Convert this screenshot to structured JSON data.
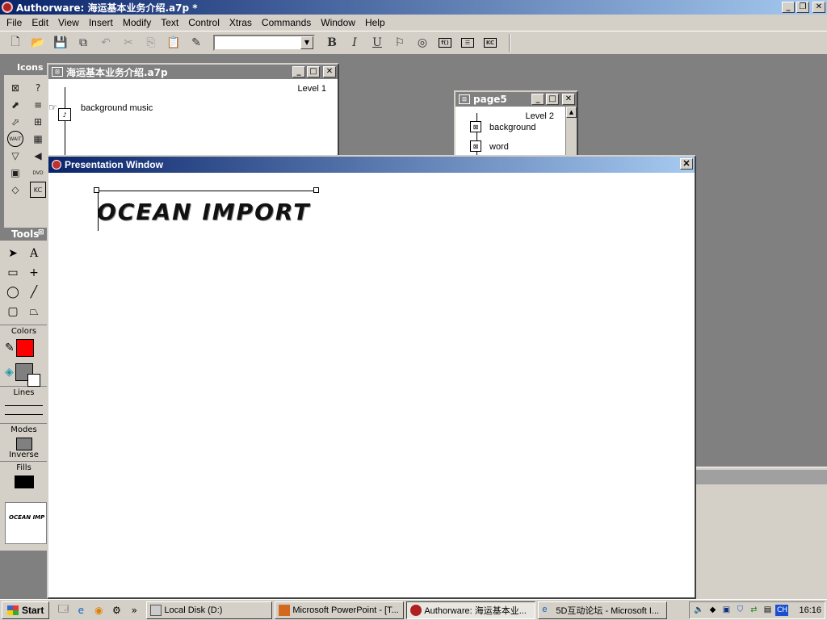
{
  "app": {
    "title": "Authorware: 海运基本业务介绍.a7p *"
  },
  "menu": [
    "File",
    "Edit",
    "View",
    "Insert",
    "Modify",
    "Text",
    "Control",
    "Xtras",
    "Commands",
    "Window",
    "Help"
  ],
  "toolbar": {
    "font_value": "",
    "bold": "B",
    "italic": "I",
    "underline": "U",
    "kc": "KC"
  },
  "icons_palette": {
    "title": "Icons",
    "wait_label": "WAIT",
    "dvd_label": "DVD",
    "kc_label": "KC"
  },
  "tools_palette": {
    "title": "Tools",
    "colors_label": "Colors",
    "lines_label": "Lines",
    "modes_label": "Modes",
    "mode_value": "Inverse",
    "fills_label": "Fills",
    "text_tool": "A",
    "thumbnail_text": "OCEAN IMP"
  },
  "flowline_main": {
    "title": "海运基本业务介绍.a7p",
    "level": "Level 1",
    "items": [
      {
        "label": "background music"
      }
    ]
  },
  "flowline_page5": {
    "title": "page5",
    "level": "Level 2",
    "items": [
      {
        "label": "background"
      },
      {
        "label": "word"
      }
    ]
  },
  "presentation": {
    "title": "Presentation Window",
    "text": "OCEAN IMPORT"
  },
  "taskbar": {
    "start": "Start",
    "tasks": [
      {
        "label": "Local Disk (D:)"
      },
      {
        "label": "Microsoft PowerPoint - [T..."
      },
      {
        "label": "Authorware: 海运基本业..."
      },
      {
        "label": "5D互动论坛 - Microsoft I..."
      }
    ],
    "tray_ch": "CH",
    "clock": "16:16"
  },
  "colors": {
    "title_gradient_start": "#0a246a",
    "title_gradient_end": "#a6caf0",
    "chrome": "#d4d0c8",
    "desktop": "#808080",
    "fill_color": "#ff0000"
  }
}
